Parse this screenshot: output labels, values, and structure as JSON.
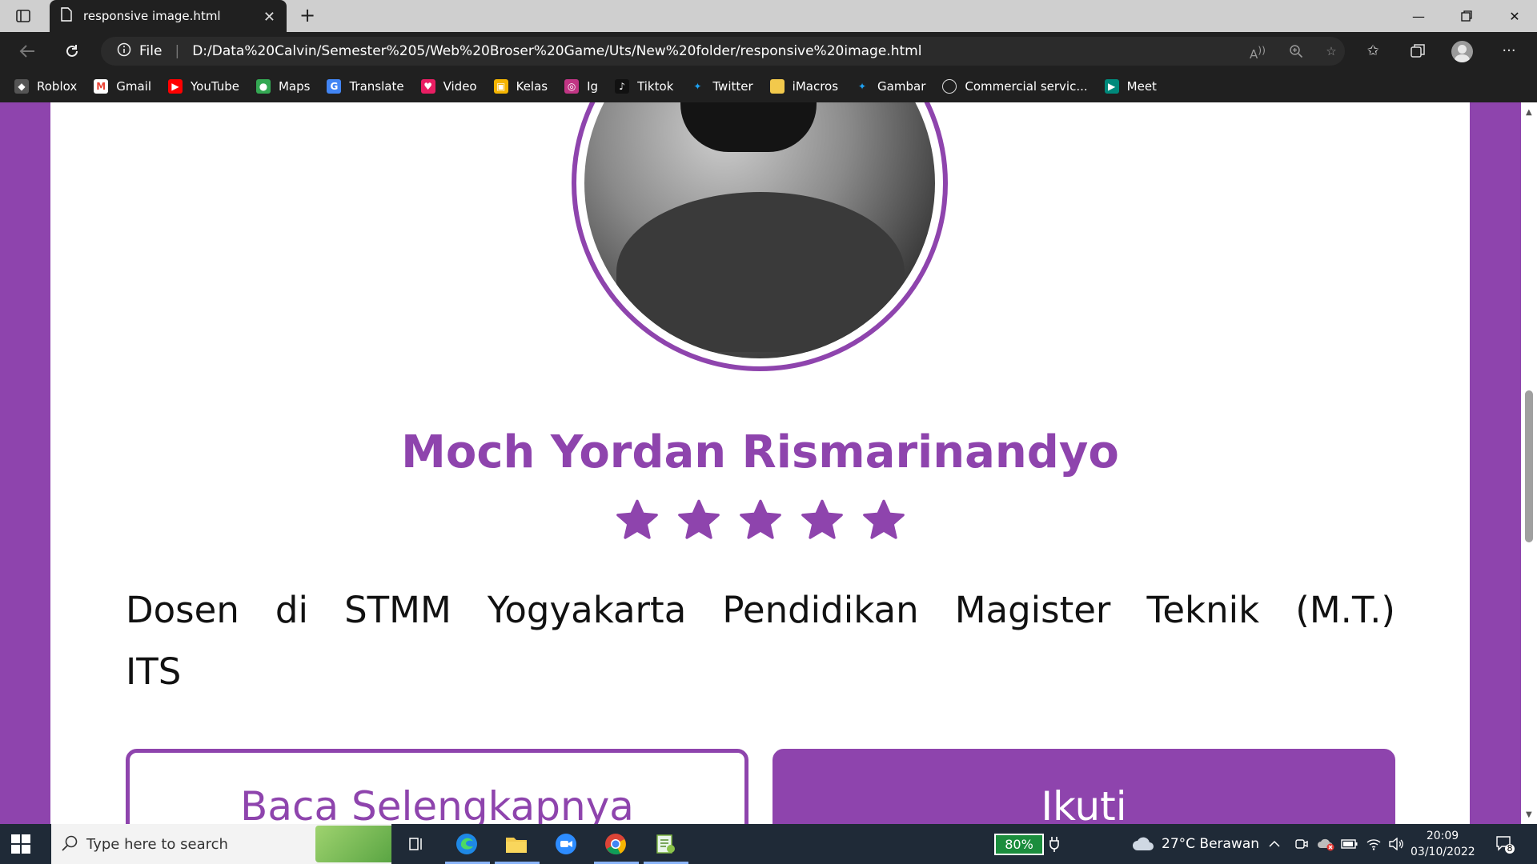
{
  "browser": {
    "tab_title": "responsive image.html",
    "address_prefix": "File",
    "url": "D:/Data%20Calvin/Semester%205/Web%20Broser%20Game/Uts/New%20folder/responsive%20image.html",
    "accent": "#202020"
  },
  "bookmarks": [
    {
      "label": "Roblox",
      "icon": "roblox-icon",
      "color": "#555555"
    },
    {
      "label": "Gmail",
      "icon": "gmail-icon",
      "color": "#ea4335"
    },
    {
      "label": "YouTube",
      "icon": "youtube-icon",
      "color": "#ff0000"
    },
    {
      "label": "Maps",
      "icon": "maps-icon",
      "color": "#34a853"
    },
    {
      "label": "Translate",
      "icon": "translate-icon",
      "color": "#4285f4"
    },
    {
      "label": "Video",
      "icon": "video-icon",
      "color": "#e91e63"
    },
    {
      "label": "Kelas",
      "icon": "classroom-icon",
      "color": "#f4b400"
    },
    {
      "label": "Ig",
      "icon": "instagram-icon",
      "color": "#c13584"
    },
    {
      "label": "Tiktok",
      "icon": "tiktok-icon",
      "color": "#111111"
    },
    {
      "label": "Twitter",
      "icon": "twitter-icon",
      "color": "#1da1f2"
    },
    {
      "label": "iMacros",
      "icon": "folder-icon",
      "color": "#f2c94c"
    },
    {
      "label": "Gambar",
      "icon": "twitter-icon",
      "color": "#1da1f2"
    },
    {
      "label": "Commercial servic...",
      "icon": "globe-icon",
      "color": "#444444"
    },
    {
      "label": "Meet",
      "icon": "meet-icon",
      "color": "#00897b"
    }
  ],
  "page": {
    "name": "Moch Yordan Rismarinandyo",
    "rating": 5,
    "rating_max": 5,
    "description": "Dosen di STMM Yogyakarta Pendidikan Magister Teknik (M.T.) ITS",
    "read_more_label": "Baca Selengkapnya",
    "follow_label": "Ikuti",
    "accent": "#8e44ad"
  },
  "taskbar": {
    "search_placeholder": "Type here to search",
    "battery": "80%",
    "weather": "27°C  Berawan",
    "time": "20:09",
    "date": "03/10/2022",
    "notification_count": "8"
  }
}
